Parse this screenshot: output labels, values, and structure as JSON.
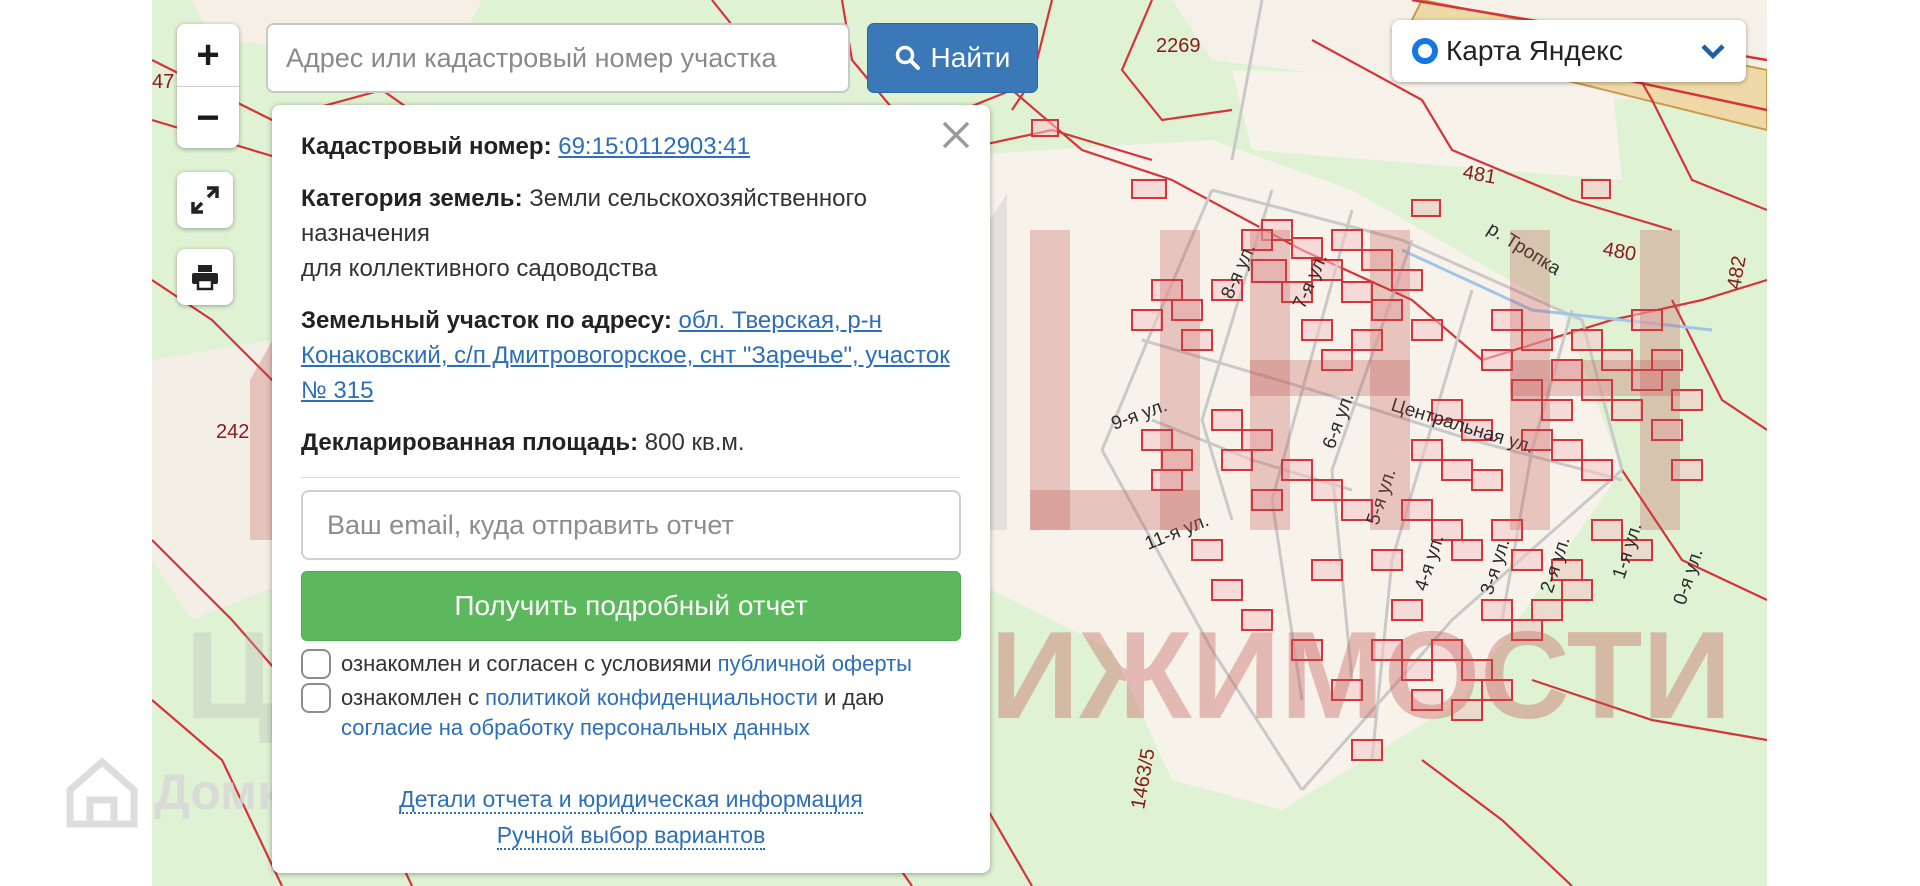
{
  "map": {
    "streets": [
      "8-я ул.",
      "7-я ул.",
      "9-я ул.",
      "6-я ул.",
      "Центральная ул.",
      "5-я ул.",
      "11-я ул.",
      "4-я ул.",
      "3-я ул.",
      "2-я ул.",
      "1-я ул.",
      "0-я ул.",
      "р. Тропка"
    ],
    "plot_numbers": [
      "2269",
      "481",
      "480",
      "482",
      "242",
      "1463/5",
      "47"
    ]
  },
  "zoom": {
    "in_label": "+",
    "out_label": "−"
  },
  "search": {
    "placeholder": "Адрес или кадастровый номер участка",
    "button_label": "Найти"
  },
  "layer": {
    "selected": "Карта Яндекс"
  },
  "panel": {
    "cadastral_label": "Кадастровый номер:",
    "cadastral_value": "69:15:0112903:41",
    "category_label": "Категория земель:",
    "category_value": "Земли сельскохозяйственного назначения",
    "category_use": "для коллективного садоводства",
    "address_label": "Земельный участок по адресу:",
    "address_value": "обл. Тверская, р-н Конаковский, с/п Дмитровогорское, снт \"Заречье\", участок № 315",
    "area_label": "Декларированная площадь:",
    "area_value": "800 кв.м.",
    "email_placeholder": "Ваш email, куда отправить отчет",
    "report_button": "Получить подробный отчет",
    "consent1_text": "ознакомлен и согласен с условиями",
    "consent1_link": "публичной оферты",
    "consent2_text_a": "ознакомлен с",
    "consent2_link_a": "политикой конфиденциальности",
    "consent2_text_b": "и даю",
    "consent2_link_b": "согласие на обработку персональных данных",
    "details_link": "Детали отчета и юридическая информация",
    "manual_link": "Ручной выбор вариантов"
  },
  "watermark": {
    "line1": "ЦЕНТР",
    "line2": "НЕДВИЖИМОСТИ",
    "brand": "Домклик"
  },
  "colors": {
    "accent": "#3b78b8",
    "green": "#5cb85c",
    "parcel": "#d6333a",
    "map_bg": "#dff2d4"
  }
}
